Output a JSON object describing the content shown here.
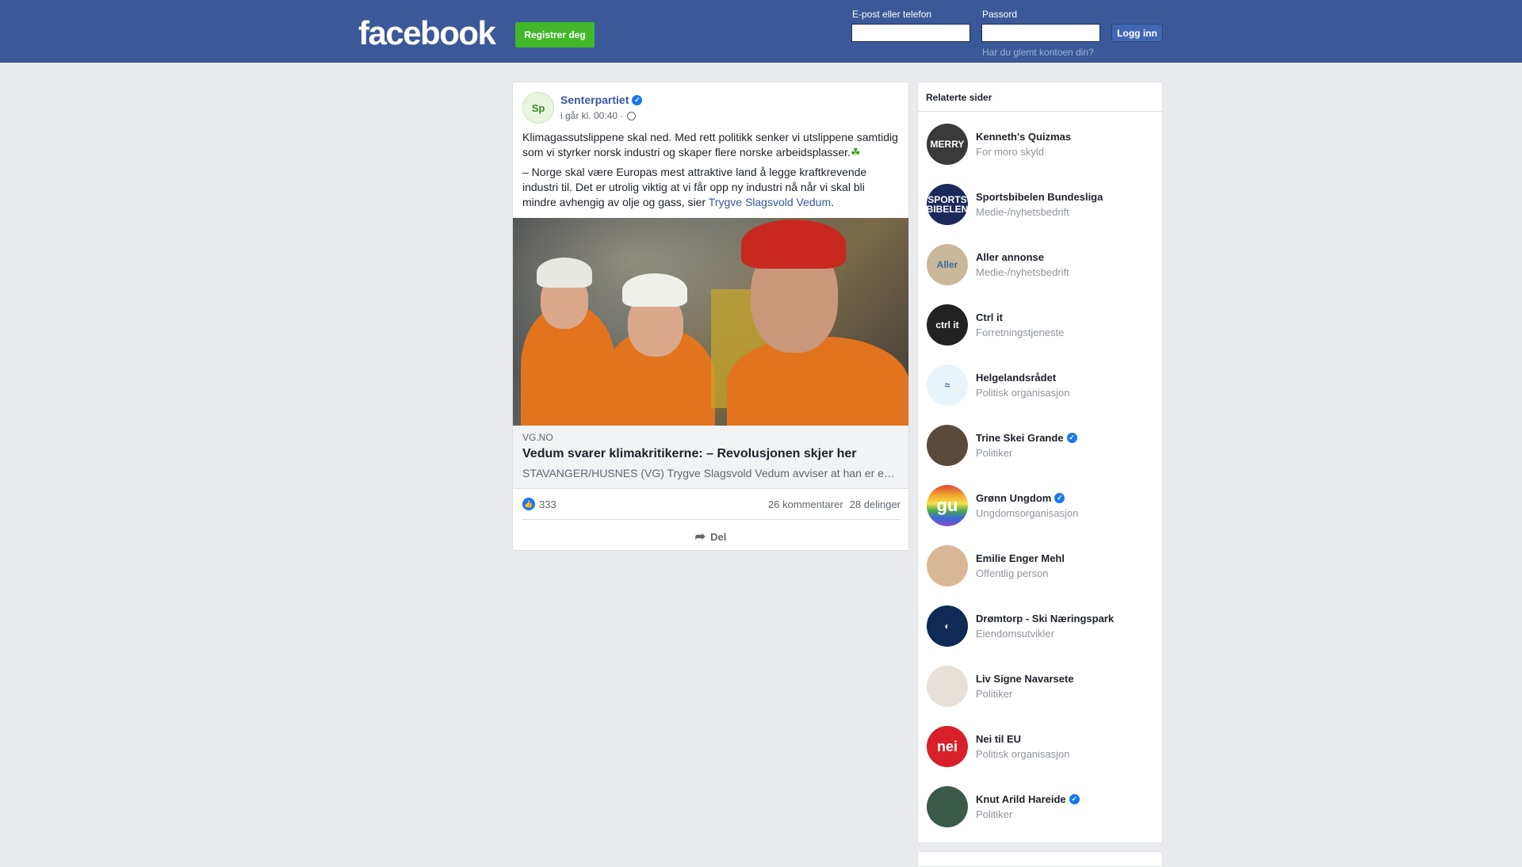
{
  "header": {
    "logo": "facebook",
    "register_label": "Registrer deg",
    "email_label": "E-post eller telefon",
    "password_label": "Passord",
    "login_label": "Logg inn",
    "forgot_label": "Har du glemt kontoen din?"
  },
  "post": {
    "author": "Senterpartiet",
    "avatar_text": "Sp",
    "time": "i går kl. 00:40 ·",
    "text_p1": "Klimagassutslippene skal ned. Med rett politikk senker vi utslippene samtidig som vi styrker norsk industri og skaper flere norske arbeidsplasser.",
    "text_p1_emoji": "☘",
    "text_p2": "– Norge skal være Europas mest attraktive land å legge kraftkrevende industri til. Det er utrolig viktig at vi får opp ny industri nå når vi skal bli mindre avhengig av olje og gass, sier ",
    "text_p2_mention": "Trygve Slagsvold Vedum",
    "text_p2_end": ".",
    "link": {
      "domain": "VG.NO",
      "title": "Vedum svarer klimakritikerne: – Revolusjonen skjer her",
      "description": "STAVANGER/HUSNES (VG) Trygve Slagsvold Vedum avviser at han er en klimaskeptiker"
    },
    "likes": "333",
    "comments": "26 kommentarer",
    "shares": "28 delinger",
    "share_label": "Del"
  },
  "related": {
    "title": "Relaterte sider",
    "items": [
      {
        "name": "Kenneth's Quizmas",
        "category": "For moro skyld",
        "verified": false,
        "avatar_text": "MERRY",
        "color": "#3a3a3a"
      },
      {
        "name": "Sportsbibelen Bundesliga",
        "category": "Medie-/nyhetsbedrift",
        "verified": false,
        "avatar_text": "SPORTS BIBELEN",
        "color": "#1a2a5a"
      },
      {
        "name": "Aller annonse",
        "category": "Medie-/nyhetsbedrift",
        "verified": false,
        "avatar_text": "Aller",
        "color": "#c9b89a"
      },
      {
        "name": "Ctrl it",
        "category": "Forretningstjeneste",
        "verified": false,
        "avatar_text": "ctrl it",
        "color": "#222222"
      },
      {
        "name": "Helgelandsrådet",
        "category": "Politisk organisasjon",
        "verified": false,
        "avatar_text": "≈",
        "color": "#e8f3fa"
      },
      {
        "name": "Trine Skei Grande",
        "category": "Politiker",
        "verified": true,
        "avatar_text": "",
        "color": "#5a4a3a"
      },
      {
        "name": "Grønn Ungdom",
        "category": "Ungdomsorganisasjon",
        "verified": true,
        "avatar_text": "gu",
        "color": "#e0463a"
      },
      {
        "name": "Emilie Enger Mehl",
        "category": "Offentlig person",
        "verified": false,
        "avatar_text": "",
        "color": "#d8b896"
      },
      {
        "name": "Drømtorp - Ski Næringspark",
        "category": "Eiendomsutvikler",
        "verified": false,
        "avatar_text": "◐",
        "color": "#0e2a55"
      },
      {
        "name": "Liv Signe Navarsete",
        "category": "Politiker",
        "verified": false,
        "avatar_text": "",
        "color": "#e6e0d8"
      },
      {
        "name": "Nei til EU",
        "category": "Politisk organisasjon",
        "verified": false,
        "avatar_text": "nei",
        "color": "#d8202a"
      },
      {
        "name": "Knut Arild Hareide",
        "category": "Politiker",
        "verified": true,
        "avatar_text": "",
        "color": "#3a5a4a"
      }
    ]
  }
}
